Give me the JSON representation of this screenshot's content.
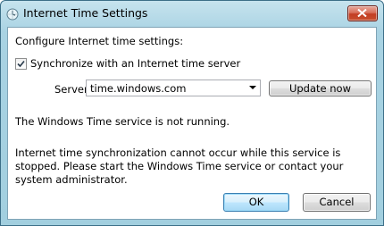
{
  "window": {
    "title": "Internet Time Settings",
    "icon": "clock-globe-icon",
    "close_icon": "close-icon"
  },
  "content": {
    "heading": "Configure Internet time settings:",
    "sync_checkbox": {
      "label": "Synchronize with an Internet time server",
      "checked": true
    },
    "server": {
      "label": "Server:",
      "value": "time.windows.com"
    },
    "update_button": "Update now",
    "status_text": "The Windows Time service is not running.",
    "message": "Internet time synchronization cannot occur while this service is stopped. Please start the Windows Time service or contact your system administrator."
  },
  "buttons": {
    "ok": "OK",
    "cancel": "Cancel"
  },
  "colors": {
    "title_bar": "#a9d3e3",
    "close_button": "#c8502f",
    "default_button_border": "#3c7fb1"
  }
}
